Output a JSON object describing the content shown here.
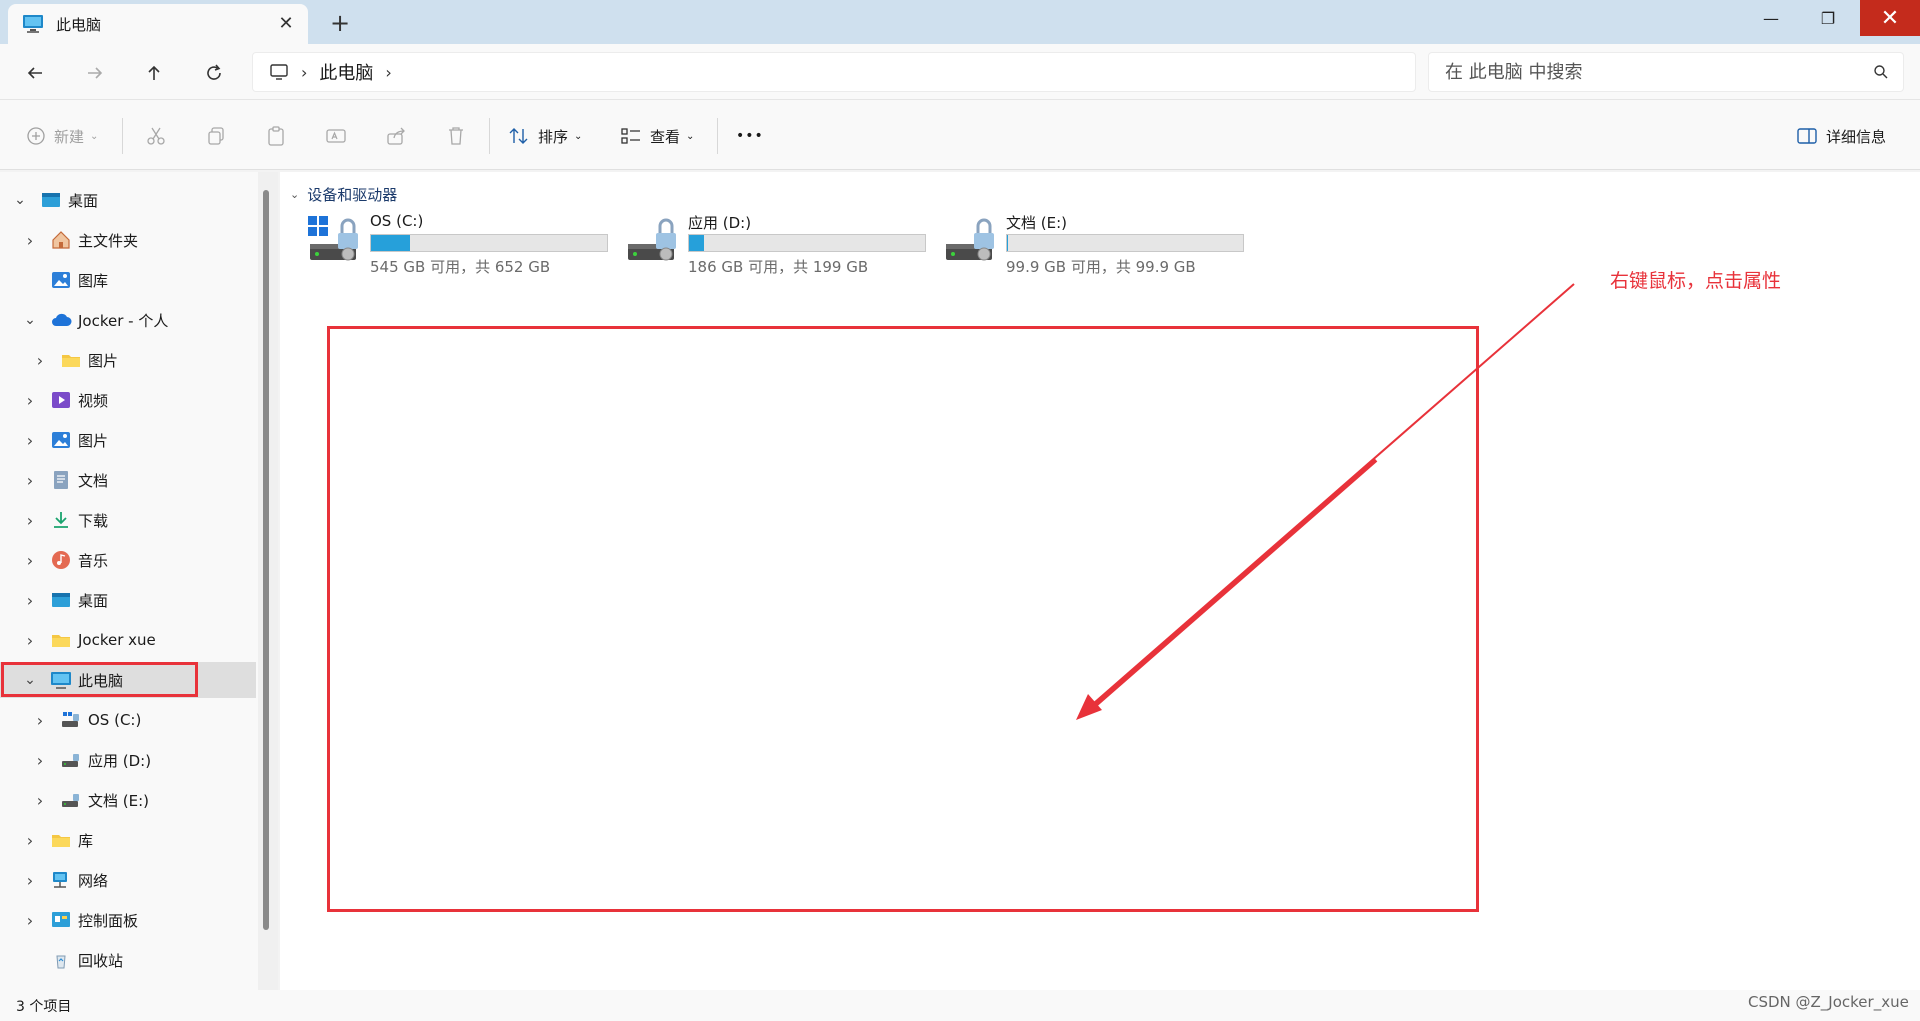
{
  "titlebar": {
    "tab_title": "此电脑",
    "new_tab": "+",
    "close_tab": "✕",
    "minimize": "—",
    "maximize": "❐",
    "close": "✕"
  },
  "address": {
    "crumb": "此电脑",
    "search_placeholder": "在 此电脑 中搜索"
  },
  "toolbar": {
    "new_label": "新建",
    "sort_label": "排序",
    "view_label": "查看",
    "more_label": "•••",
    "details_label": "详细信息"
  },
  "sidebar": {
    "items": [
      {
        "label": "桌面"
      },
      {
        "label": "主文件夹"
      },
      {
        "label": "图库"
      },
      {
        "label": "Jocker - 个人"
      },
      {
        "label": "图片"
      },
      {
        "label": "视频"
      },
      {
        "label": "图片"
      },
      {
        "label": "文档"
      },
      {
        "label": "下载"
      },
      {
        "label": "音乐"
      },
      {
        "label": "桌面"
      },
      {
        "label": "Jocker xue"
      },
      {
        "label": "此电脑"
      },
      {
        "label": "OS (C:)"
      },
      {
        "label": "应用 (D:)"
      },
      {
        "label": "文档 (E:)"
      },
      {
        "label": "库"
      },
      {
        "label": "网络"
      },
      {
        "label": "控制面板"
      },
      {
        "label": "回收站"
      }
    ]
  },
  "content": {
    "group_header": "设备和驱动器",
    "drives": [
      {
        "name": "OS (C:)",
        "free_text": "545 GB 可用，共 652 GB",
        "used_fraction": 0.164
      },
      {
        "name": "应用 (D:)",
        "free_text": "186 GB 可用，共 199 GB",
        "used_fraction": 0.065
      },
      {
        "name": "文档 (E:)",
        "free_text": "99.9 GB 可用，共 99.9 GB",
        "used_fraction": 0.002
      }
    ],
    "annotation": "右键鼠标，点击属性"
  },
  "status": {
    "count": "3 个项目",
    "watermark": "CSDN @Z_Jocker_xue"
  },
  "colors": {
    "accent": "#26a0da",
    "annotation_red": "#e8323a",
    "titlebar_bg": "#cfe0ee"
  }
}
